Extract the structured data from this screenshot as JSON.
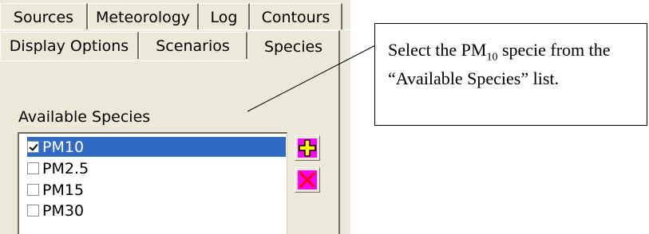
{
  "tabs": {
    "row1": [
      "Sources",
      "Meteorology",
      "Log",
      "Contours"
    ],
    "row2": [
      "Display Options",
      "Scenarios",
      "Species"
    ],
    "selected": "Species"
  },
  "species_panel": {
    "heading": "Available Species",
    "items": [
      {
        "label": "PM10",
        "checked": true,
        "selected": true
      },
      {
        "label": "PM2.5",
        "checked": false,
        "selected": false
      },
      {
        "label": "PM15",
        "checked": false,
        "selected": false
      },
      {
        "label": "PM30",
        "checked": false,
        "selected": false
      }
    ],
    "buttons": [
      {
        "icon": "add-plus-icon",
        "color": "#ff00ff"
      },
      {
        "icon": "remove-x-icon",
        "color": "#ff00ff"
      }
    ]
  },
  "callout": {
    "text_before": "Select the PM",
    "subscript": "10",
    "text_after": " specie from the “Available Species” list."
  },
  "colors": {
    "panel_bg": "#ece9d8",
    "selection": "#316ac5",
    "button_face": "#ff00ff"
  }
}
